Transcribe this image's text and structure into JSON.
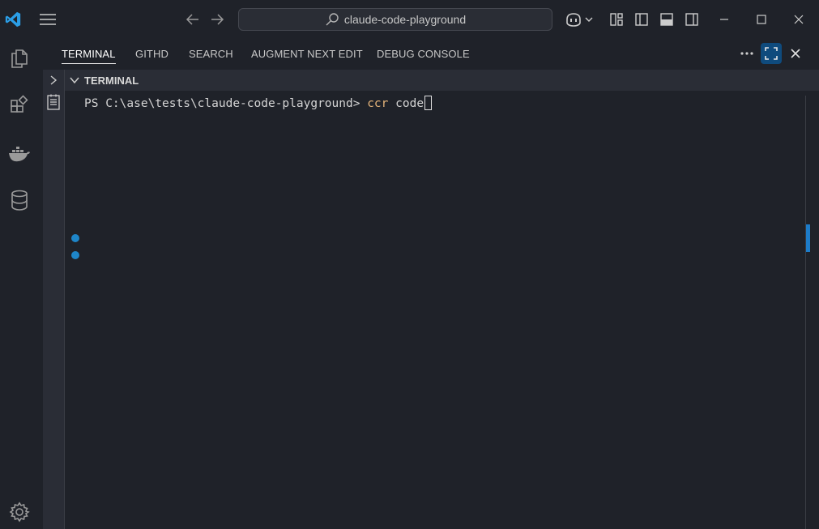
{
  "titlebar": {
    "search_text": "claude-code-playground"
  },
  "panel": {
    "tabs": [
      {
        "label": "TERMINAL",
        "active": true
      },
      {
        "label": "GITHD",
        "active": false
      },
      {
        "label": "SEARCH",
        "active": false
      },
      {
        "label": "AUGMENT NEXT EDIT",
        "active": false
      },
      {
        "label": "DEBUG CONSOLE",
        "active": false
      }
    ],
    "section_title": "TERMINAL"
  },
  "terminal": {
    "prompt": "PS C:\\ase\\tests\\claude-code-playground> ",
    "command_name": "ccr",
    "command_args": " code"
  },
  "colors": {
    "accent": "#1e86c9",
    "background": "#1f2229",
    "command": "#e5b47a"
  }
}
